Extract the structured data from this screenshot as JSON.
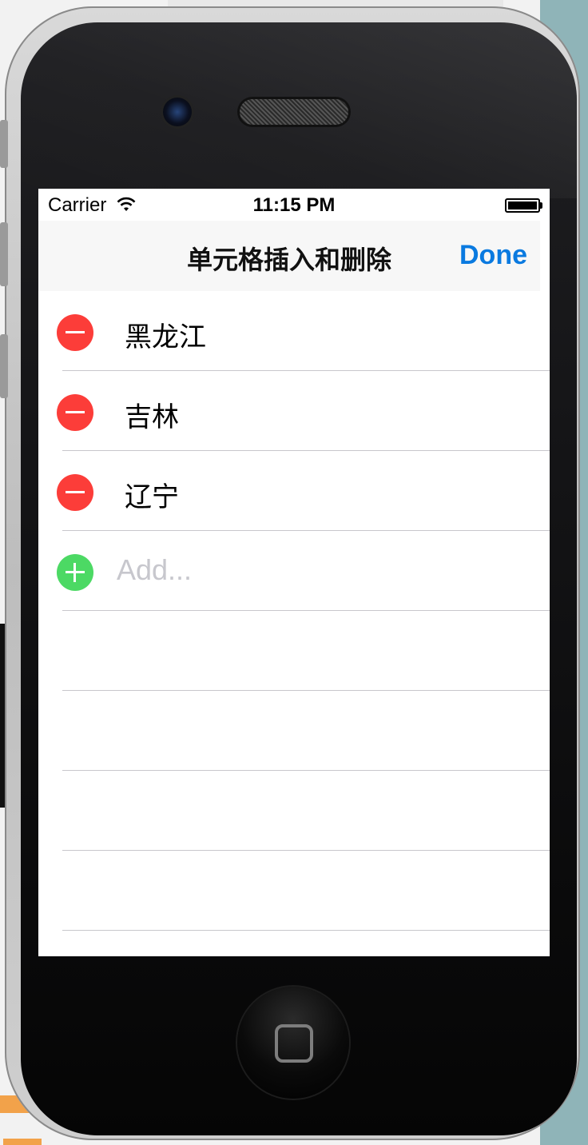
{
  "status_bar": {
    "carrier": "Carrier",
    "time": "11:15 PM",
    "wifi_icon": "wifi-icon",
    "battery_icon": "battery-full-icon",
    "battery_level": 1.0
  },
  "nav_bar": {
    "title": "单元格插入和删除",
    "done_label": "Done",
    "accent_color": "#0a7ae0"
  },
  "table": {
    "rows": [
      {
        "label": "黑龙江",
        "edit_control": "delete-icon"
      },
      {
        "label": "吉林",
        "edit_control": "delete-icon"
      },
      {
        "label": "辽宁",
        "edit_control": "delete-icon"
      }
    ],
    "add_row": {
      "placeholder": "Add...",
      "value": "",
      "edit_control": "insert-icon"
    },
    "empty_rows": 4,
    "delete_color": "#fc3d39",
    "insert_color": "#4cd964"
  }
}
